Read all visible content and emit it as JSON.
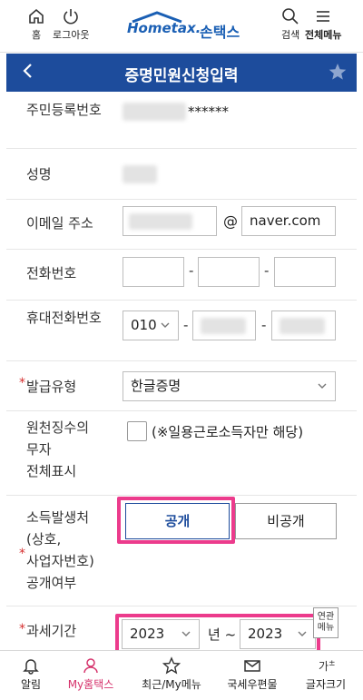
{
  "header": {
    "home_label": "홈",
    "logout_label": "로그아웃",
    "logo_text": "Hometax.",
    "logo_kr": "손택스",
    "search_label": "검색",
    "menu_label": "전체메뉴"
  },
  "titlebar": {
    "title": "증명민원신청입력",
    "back_icon": "chevron-left-icon",
    "star_icon": "star-icon"
  },
  "form": {
    "resident_number_label": "주민등록번호",
    "resident_number_masked": "******",
    "name_label": "성명",
    "email_label": "이메일 주소",
    "email_at": "@",
    "email_domain": "naver.com",
    "phone_label": "전화번호",
    "mobile_label": "휴대전화번호",
    "mobile_prefix": "010",
    "issue_type_label": "발급유형",
    "issue_type_value": "한글증명",
    "withholding_label_1": "원천징수의",
    "withholding_label_2": "무자",
    "withholding_label_3": "전체표시",
    "withholding_checkbox_text": "(※일용근로소득자만 해당)",
    "income_source_label_1": "소득발생처",
    "income_source_label_2": "(상호,",
    "income_source_label_3": "사업자번호)",
    "income_source_label_4": "공개여부",
    "public_button": "공개",
    "private_button": "비공개",
    "tax_period_label": "과세기간",
    "tax_year_from": "2023",
    "tax_year_separator": "년 ~",
    "tax_year_to": "2023",
    "side_tab_line1": "연관",
    "side_tab_line2": "메뉴"
  },
  "bottom_nav": {
    "items": [
      {
        "label": "알림",
        "icon": "bell-icon"
      },
      {
        "label": "My홈택스",
        "icon": "person-icon"
      },
      {
        "label": "최근/My메뉴",
        "icon": "star-icon"
      },
      {
        "label": "국세우편물",
        "icon": "mail-icon"
      },
      {
        "label": "글자크기",
        "icon": "text-size-icon"
      }
    ]
  },
  "colors": {
    "brand_blue": "#1d4c9c",
    "highlight_pink": "#ec3b8c",
    "required_red": "#d62f2f"
  }
}
